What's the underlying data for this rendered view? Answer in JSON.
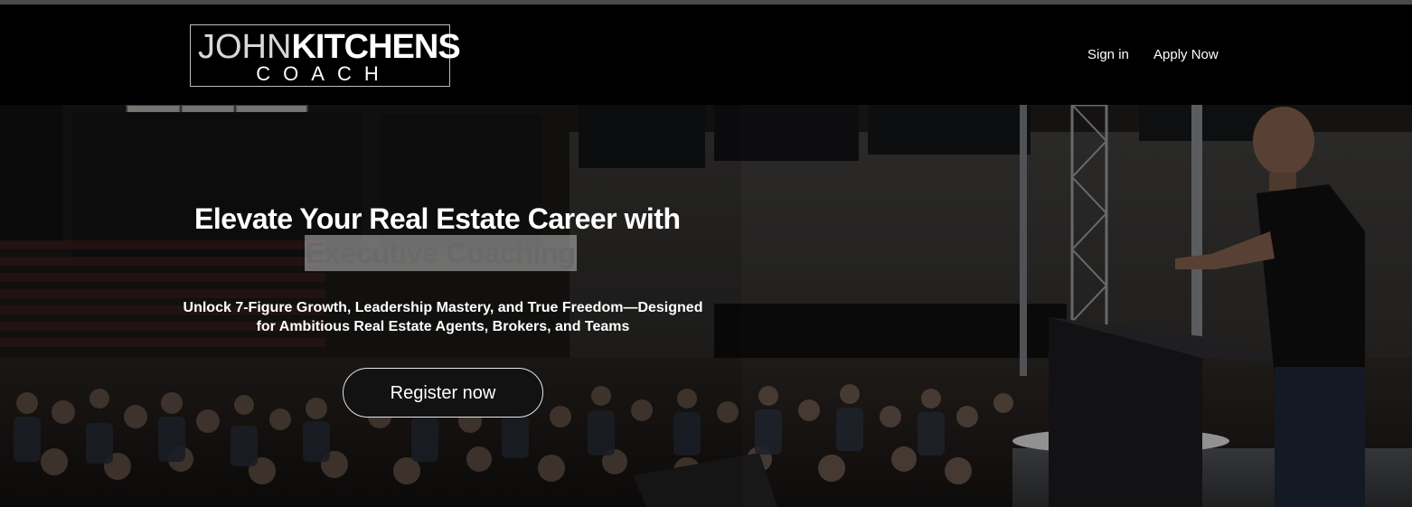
{
  "logo": {
    "line1_thin": "JOHN",
    "line1_bold": "KITCHENS",
    "line2": "COACH"
  },
  "nav": {
    "signin": "Sign in",
    "apply": "Apply Now"
  },
  "hero": {
    "title_line1": "Elevate Your Real Estate Career with",
    "title_highlight": "Executive Coaching",
    "subtitle_line1": "Unlock 7-Figure Growth, Leadership Mastery, and True Freedom—Designed",
    "subtitle_line2": "for Ambitious Real Estate Agents, Brokers, and Teams",
    "cta": "Register now"
  },
  "colors": {
    "header_bg": "#000000",
    "highlight_bg": "#bebebe",
    "button_bg": "#121212"
  }
}
